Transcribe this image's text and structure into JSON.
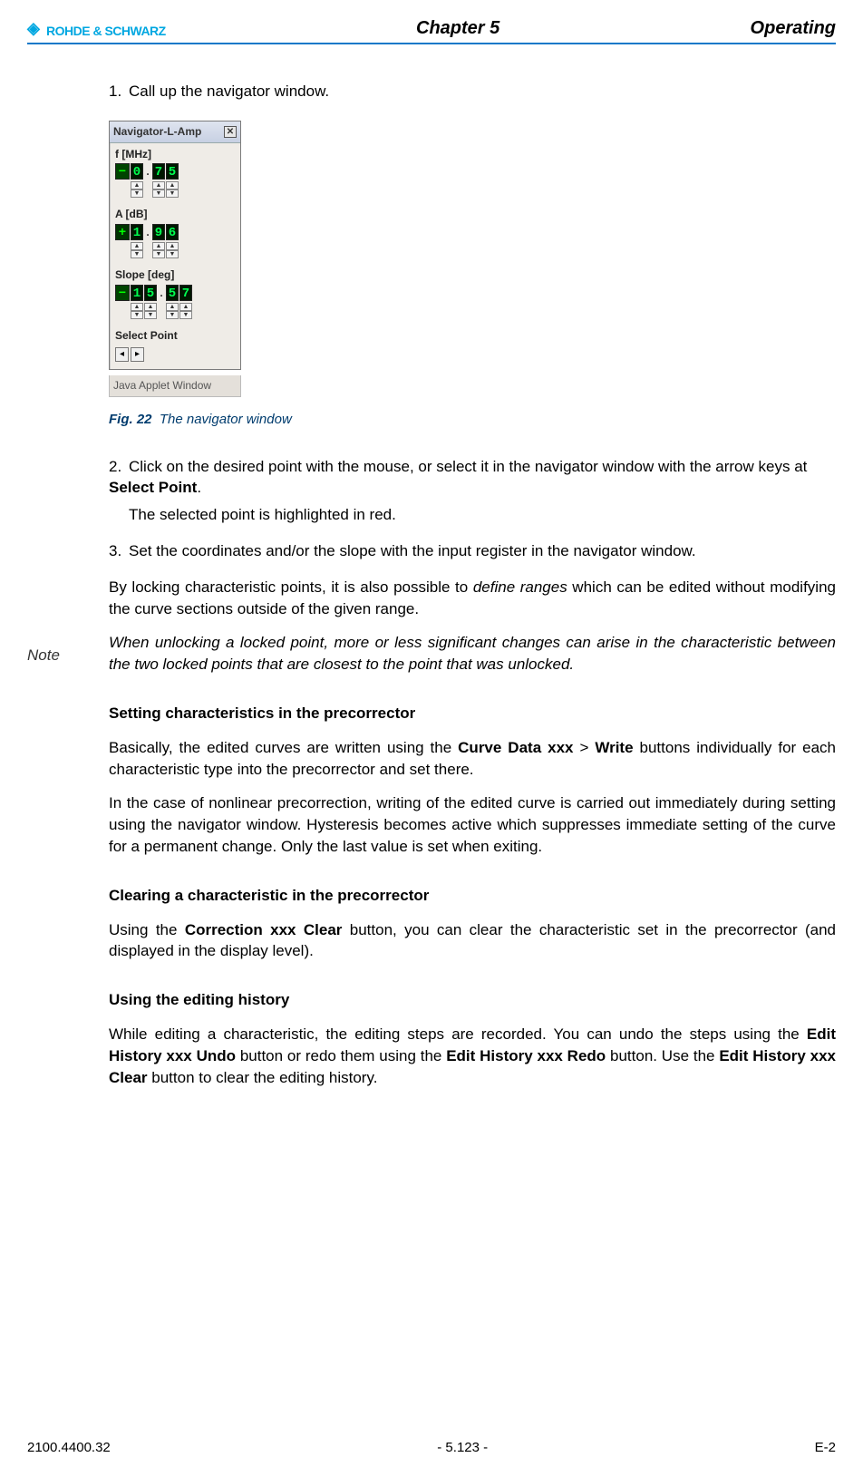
{
  "header": {
    "brand": "ROHDE & SCHWARZ",
    "chapter": "Chapter 5",
    "section": "Operating"
  },
  "steps": {
    "s1": {
      "num": "1.",
      "text": "Call up the navigator window."
    },
    "s2": {
      "num": "2.",
      "text_a": "Click on the desired point with the mouse, or select it in the navigator window with the arrow keys at ",
      "bold": "Select Point",
      "text_b": ".",
      "para2": "The selected point is highlighted in red."
    },
    "s3": {
      "num": "3.",
      "text": "Set the coordinates and/or the slope with the input register in the navigator window."
    }
  },
  "fig": {
    "label": "Fig. 22",
    "caption": "The navigator window"
  },
  "nav": {
    "title": "Navigator-L-Amp",
    "close": "✕",
    "f_label": "f [MHz]",
    "f_sign": "−",
    "f_d1": "0",
    "f_d2": "7",
    "f_d3": "5",
    "a_label": "A [dB]",
    "a_sign": "+",
    "a_d1": "1",
    "a_d2": "9",
    "a_d3": "6",
    "s_label": "Slope [deg]",
    "s_sign": "−",
    "s_d1": "1",
    "s_d2": "5",
    "s_d3": "5",
    "s_d4": "7",
    "sel_label": "Select Point",
    "arrow_l": "◂",
    "arrow_r": "▸",
    "applet": "Java Applet Window"
  },
  "paras": {
    "lock_a": "By locking characteristic points, it is also possible to ",
    "lock_em": "define ranges",
    "lock_b": " which can be edited without modifying the curve sections outside of the given range.",
    "note_label": "Note",
    "note": "When unlocking a locked point, more or less significant changes can arise in the characteristic between the two locked points that are closest to the point that was unlocked."
  },
  "sec1": {
    "heading": "Setting characteristics in the precorrector",
    "p1_a": "Basically, the edited curves are written using the ",
    "p1_b1": "Curve Data xxx",
    "p1_mid": " > ",
    "p1_b2": "Write",
    "p1_c": " buttons individually for each characteristic type into the precorrector and set there.",
    "p2": "In the case of nonlinear precorrection, writing of the edited curve is carried out immediately during setting using the navigator window. Hysteresis becomes active which suppresses immediate setting of the curve for a permanent change. Only the last value is set when exiting."
  },
  "sec2": {
    "heading": "Clearing a characteristic in the precorrector",
    "p_a": "Using the ",
    "p_b": "Correction xxx Clear",
    "p_c": " button, you can clear the characteristic set in the precorrector (and displayed in the display level)."
  },
  "sec3": {
    "heading": "Using the editing history",
    "p_a": "While editing a characteristic, the editing steps are recorded. You can undo the steps using the ",
    "p_b1": "Edit History xxx Undo",
    "p_mid1": " button or redo them using the ",
    "p_b2": "Edit History xxx Redo",
    "p_mid2": " button. Use the ",
    "p_b3": "Edit History xxx Clear",
    "p_end": " button to clear the editing history."
  },
  "footer": {
    "left": "2100.4400.32",
    "center": "- 5.123 -",
    "right": "E-2"
  }
}
